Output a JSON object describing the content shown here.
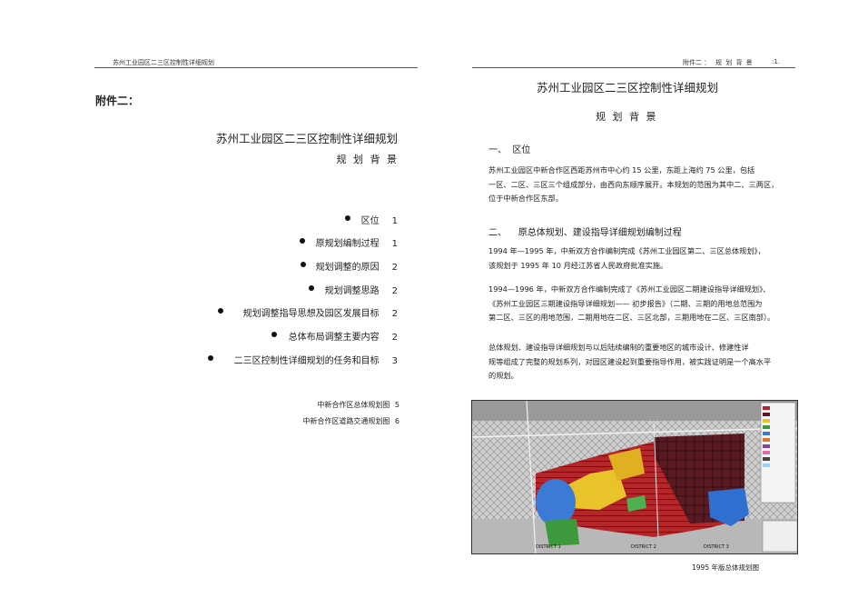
{
  "left_page": {
    "header_text": "苏州工业园区二三区控制性详细规划",
    "attachment_label": "附件二：",
    "title": "苏州工业园区二三区控制性详细规划",
    "subtitle": "规 划 背 景",
    "toc": [
      {
        "label": "区位",
        "page": "1"
      },
      {
        "label": "原规划编制过程",
        "page": "1"
      },
      {
        "label": "规划调整的原因",
        "page": "2"
      },
      {
        "label": "规划调整思路",
        "page": "2"
      },
      {
        "label": "规划调整指导思想及园区发展目标",
        "page": "2"
      },
      {
        "label": "总体布局调整主要内容",
        "page": "2"
      },
      {
        "label": "二三区控制性详细规划的任务和目标",
        "page": "3"
      }
    ],
    "figure_list": [
      {
        "label": "中新合作区总体规划图",
        "page": "5"
      },
      {
        "label": "中新合作区道路交通规划图",
        "page": "6"
      }
    ]
  },
  "right_page": {
    "header_left": "附件二 ：",
    "header_mid": "规 划 背 景",
    "header_right": ":1.",
    "title": "苏州工业园区二三区控制性详细规划",
    "subtitle": "规 划 背 景",
    "section1_heading": "一、  区位",
    "section1_lines": [
      "苏州工业园区中新合作区西距苏州市中心约 15 公里，东距上海约 75 公里，包括",
      "一区、二区、三区三个组成部分，由西向东顺序展开。本规划的范围为其中二、三两区，",
      "位于中新合作区东部。"
    ],
    "section2_heading": "二、    原总体规划、建设指导详细规划编制过程",
    "p1_lines": [
      "1994 年—1995 年，中新双方合作编制完成《苏州工业园区第二、三区总体规划》，",
      "该规划于 1995 年 10 月经江苏省人民政府批准实施。"
    ],
    "p2_lines": [
      "1994—1996 年，中新双方合作编制完成了《苏州工业园区二期建设指导详细规划》、",
      "《苏州工业园区三期建设指导详细规划—— 初步报告》（二期、三期的用地总范围为",
      "第二区、三区的用地范围，二期用地在二区、三区北部，三期用地在二区、三区南部）。"
    ],
    "p3_lines": [
      "总体规划、建设指导详细规划与以后陆续编制的重要地区的城市设计、修建性详",
      "规等组成了完整的规划系列，对园区建设起到重要指导作用，被实践证明是一个高水平",
      "的规划。"
    ],
    "map_caption": "1995 年版总体规划图",
    "map_labels": [
      "DISTRICT 1",
      "DISTRICT 2",
      "DISTRICT 3"
    ]
  }
}
